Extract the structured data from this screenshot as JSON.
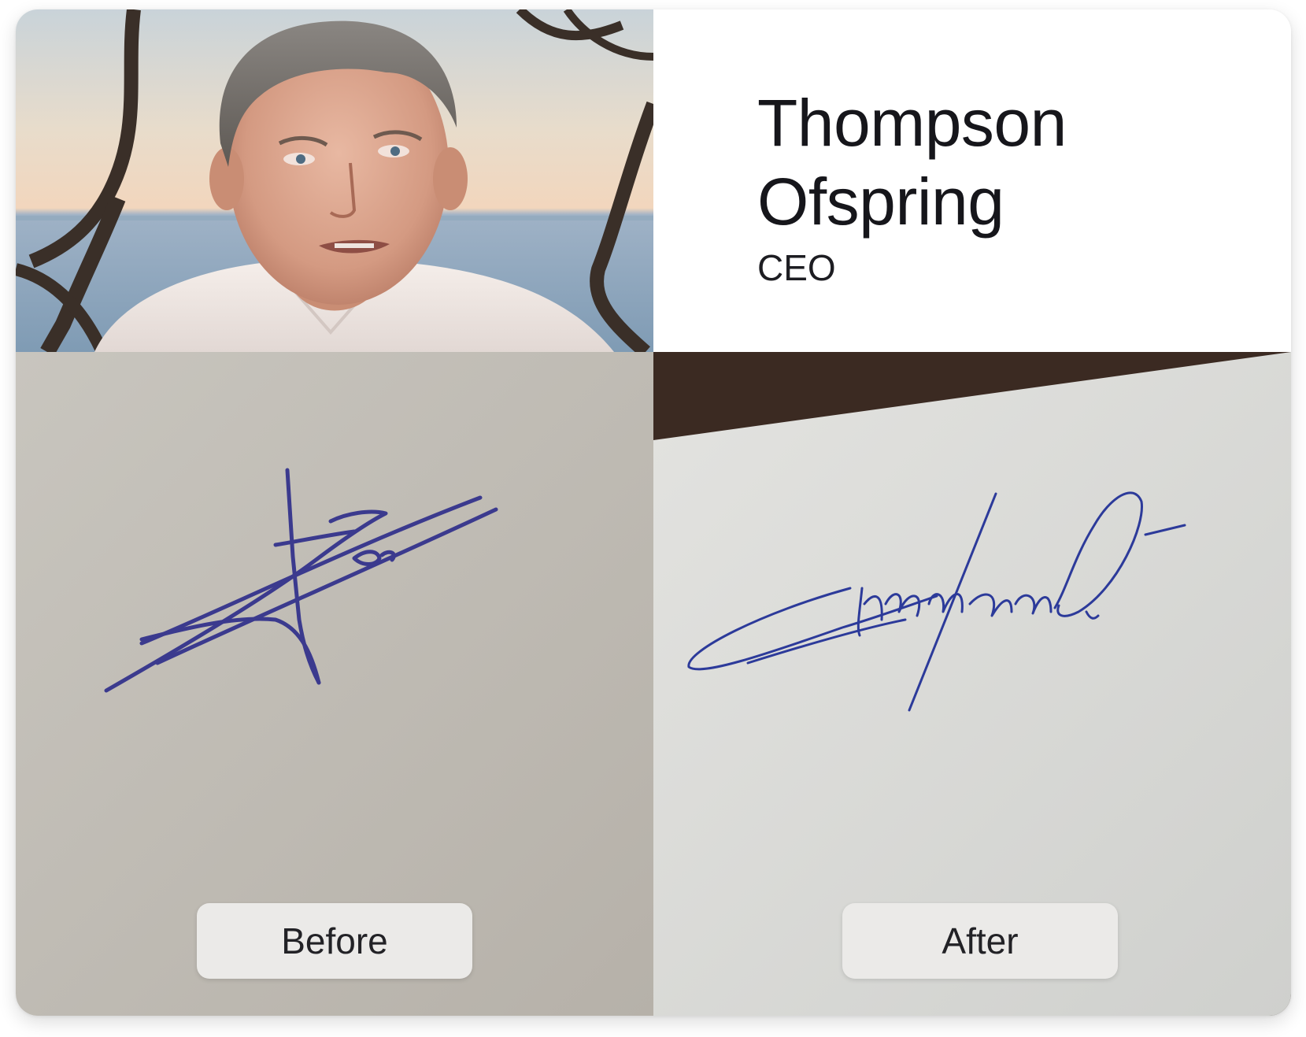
{
  "person": {
    "first_name": "Thompson",
    "last_name": "Ofspring",
    "role": "CEO"
  },
  "panels": {
    "before": {
      "label": "Before"
    },
    "after": {
      "label": "After"
    }
  },
  "colors": {
    "ink_before": "#3b3a8e",
    "ink_after": "#2c3a9a",
    "paper_before": "#c4c0b8",
    "paper_after": "#dcdcd9",
    "label_bg": "#ebeae8"
  },
  "images": {
    "portrait": "portrait-photo",
    "before_signature": "signature-before",
    "after_signature": "signature-after"
  }
}
